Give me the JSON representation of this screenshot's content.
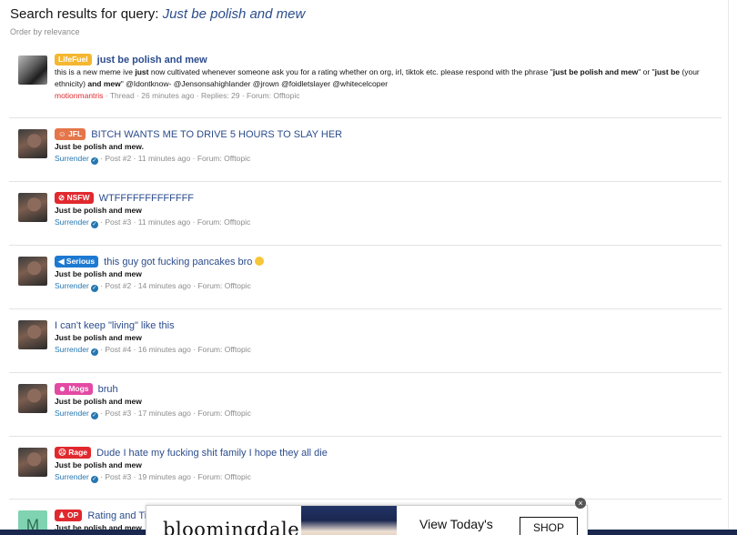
{
  "search": {
    "title_prefix": "Search results for query:",
    "query": "Just be polish and mew",
    "order_label": "Order by relevance"
  },
  "results": [
    {
      "badge": "LifeFuel",
      "badge_color": "#f5b731",
      "title": "just be polish and mew",
      "snippet_html": "this is a new meme ive <b>just</b> now cultivated whenever someone ask you for a rating whether on org, irl, tiktok etc. please respond with the phrase \"<b>just be polish and mew</b>\" or \"<b>just be</b> (your ethnicity) <b>and mew</b>\" @Idontknow- @Jensonsahighlander @jrown @foidletslayer @whitecelcoper",
      "user": "motionmantris",
      "verified": false,
      "meta": "Thread · 26 minutes ago · Replies: 29 · Forum: Offtopic"
    },
    {
      "badge": "JFL",
      "badge_color": "#e4764a",
      "title": "BITCH WANTS ME TO DRIVE 5 HOURS TO SLAY HER",
      "snippet": "Just be polish and mew.",
      "user": "Surrender",
      "verified": true,
      "meta": "Post #2 · 11 minutes ago · Forum: Offtopic"
    },
    {
      "badge": "NSFW",
      "badge_color": "#e0292e",
      "title": "WTFFFFFFFFFFFFF",
      "snippet": "Just be polish and mew",
      "user": "Surrender",
      "verified": true,
      "meta": "Post #3 · 11 minutes ago · Forum: Offtopic"
    },
    {
      "badge": "Serious",
      "badge_color": "#1d79d1",
      "title": "this guy got fucking pancakes bro",
      "snippet": "Just be polish and mew",
      "user": "Surrender",
      "verified": true,
      "meta": "Post #2 · 14 minutes ago · Forum: Offtopic"
    },
    {
      "badge": "",
      "badge_color": "",
      "title": "I can't keep \"living\" like this",
      "snippet": "Just be polish and mew",
      "user": "Surrender",
      "verified": true,
      "meta": "Post #4 · 16 minutes ago · Forum: Offtopic"
    },
    {
      "badge": "Mogs",
      "badge_color": "#e34aa3",
      "title": "bruh",
      "snippet": "Just be polish and mew",
      "user": "Surrender",
      "verified": true,
      "meta": "Post #3 · 17 minutes ago · Forum: Offtopic"
    },
    {
      "badge": "Rage",
      "badge_color": "#e0292e",
      "title": "Dude I hate my fucking shit family I hope they all die",
      "snippet": "Just be polish and mew",
      "user": "Surrender",
      "verified": true,
      "meta": "Post #3 · 19 minutes ago · Forum: Offtopic"
    },
    {
      "badge": "OP",
      "badge_color": "#e0292e",
      "title": "Rating and Tip",
      "snippet": "Just be polish and mew",
      "avatar_letter": "M"
    }
  ],
  "ad": {
    "brand": "bloomingdale's",
    "cta_text": "View Today's",
    "shop_label": "SHOP",
    "close_glyph": "×"
  }
}
